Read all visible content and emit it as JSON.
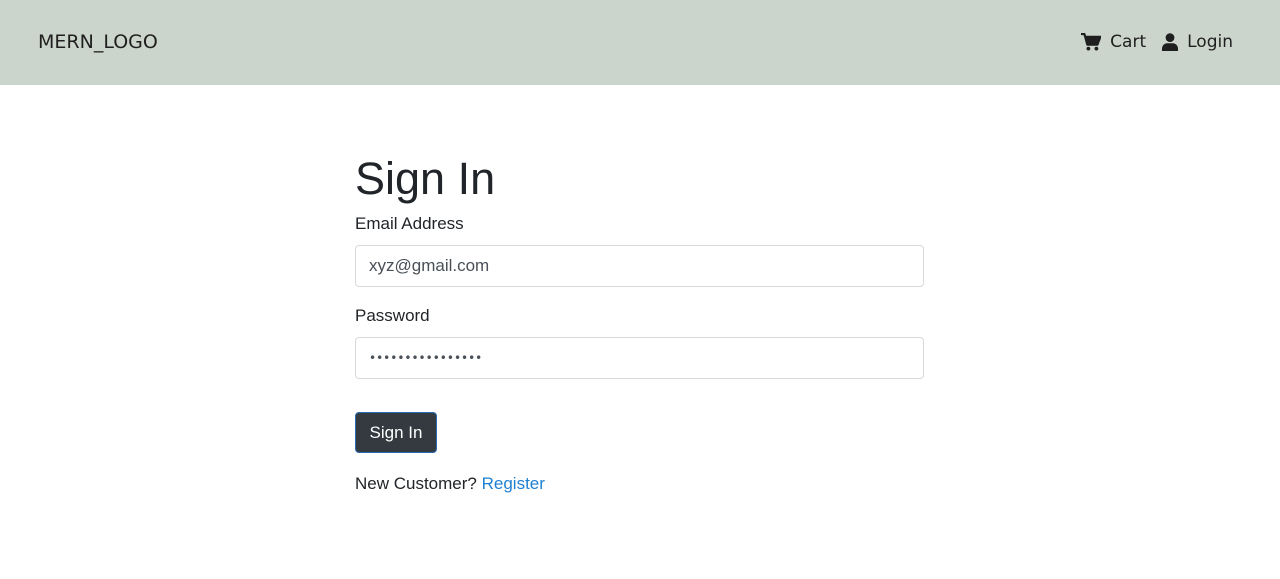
{
  "navbar": {
    "brand": "MERN_LOGO",
    "links": [
      {
        "icon": "cart-icon",
        "label": "Cart"
      },
      {
        "icon": "user-icon",
        "label": "Login"
      }
    ]
  },
  "form": {
    "title": "Sign In",
    "email_label": "Email Address",
    "email_value": "xyz@gmail.com",
    "password_label": "Password",
    "password_value": "••••••••••••••••",
    "submit_label": "Sign In",
    "footer_prompt": "New Customer?",
    "register_link": "Register"
  },
  "colors": {
    "navbar_bg": "#ccd5cc",
    "button_bg": "#343a40",
    "link": "#1f7fd1"
  }
}
